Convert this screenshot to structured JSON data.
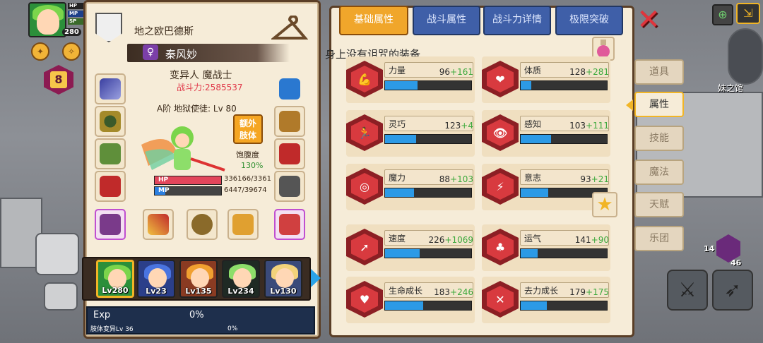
{
  "hud": {
    "hp_label": "HP",
    "mp_label": "MP",
    "sp_label": "SP",
    "level": "280",
    "hex_number": "8"
  },
  "char": {
    "org_name": "地之欧巴德斯",
    "name": "秦风妙",
    "gender_symbol": "♀",
    "class": "变异人 魔战士",
    "power": "战斗力:2585537",
    "rank": "A阶 地狱使徒: Lv 80",
    "extra_limb_label": "额外肢体",
    "satiety_label": "饱腹度",
    "satiety_value": "130%",
    "hp_label": "HP",
    "mp_label": "MP",
    "hp_text": "336166/3361",
    "mp_text": "6447/39674",
    "hp_fill": 1.0,
    "mp_fill": 0.16
  },
  "party": [
    {
      "lv": "Lv280",
      "color": "#2b8f3a",
      "hair": "#7bd54b"
    },
    {
      "lv": "Lv23",
      "color": "#2b3f8a",
      "hair": "#4a74e0"
    },
    {
      "lv": "Lv135",
      "color": "#8a3b22",
      "hair": "#f0a030"
    },
    {
      "lv": "Lv234",
      "color": "#1f2a24",
      "hair": "#8dde6a"
    },
    {
      "lv": "Lv130",
      "color": "#3a4a7a",
      "hair": "#f2d27a"
    }
  ],
  "exp": {
    "label": "Exp",
    "pct": "0%",
    "limb_label": "肢体变异Lv 36",
    "limb_pct": "0%"
  },
  "tabs": [
    "基础属性",
    "战斗属性",
    "战斗力详情",
    "极限突破"
  ],
  "curse_text": "身上没有诅咒的装备",
  "stats": [
    {
      "name": "力量",
      "base": "96",
      "bonus": "+161",
      "fill": 0.38,
      "glyph": "💪"
    },
    {
      "name": "体质",
      "base": "128",
      "bonus": "+281",
      "fill": 0.12,
      "glyph": "❤"
    },
    {
      "name": "灵巧",
      "base": "123",
      "bonus": "+4",
      "fill": 0.36,
      "glyph": "🏃"
    },
    {
      "name": "感知",
      "base": "103",
      "bonus": "+111",
      "fill": 0.35,
      "glyph": "👁"
    },
    {
      "name": "魔力",
      "base": "88",
      "bonus": "+103",
      "fill": 0.34,
      "glyph": "◎"
    },
    {
      "name": "意志",
      "base": "93",
      "bonus": "+21",
      "fill": 0.32,
      "glyph": "⚡"
    },
    {
      "name": "速度",
      "base": "226",
      "bonus": "+1069",
      "fill": 0.4,
      "glyph": "➚"
    },
    {
      "name": "运气",
      "base": "141",
      "bonus": "+90",
      "fill": 0.2,
      "glyph": "♣"
    },
    {
      "name": "生命成长",
      "base": "183",
      "bonus": "+246",
      "fill": 0.44,
      "glyph": "♥"
    },
    {
      "name": "去力成长",
      "base": "179",
      "bonus": "+175",
      "fill": 0.3,
      "glyph": "✕"
    }
  ],
  "side_tabs": [
    "道具",
    "属性",
    "技能",
    "魔法",
    "天赋",
    "乐团"
  ],
  "world": {
    "sister_shop": "妹之馆",
    "jar_count": "14",
    "hex_count": "46"
  },
  "colors": {
    "panel_bg": "#f6ecd8",
    "tab_active": "#f0a62b",
    "tab_inactive": "#3f5fa8",
    "stat_bar": "#2c9ae6",
    "bonus_green": "#3ca93c",
    "power_red": "#e0394a"
  }
}
